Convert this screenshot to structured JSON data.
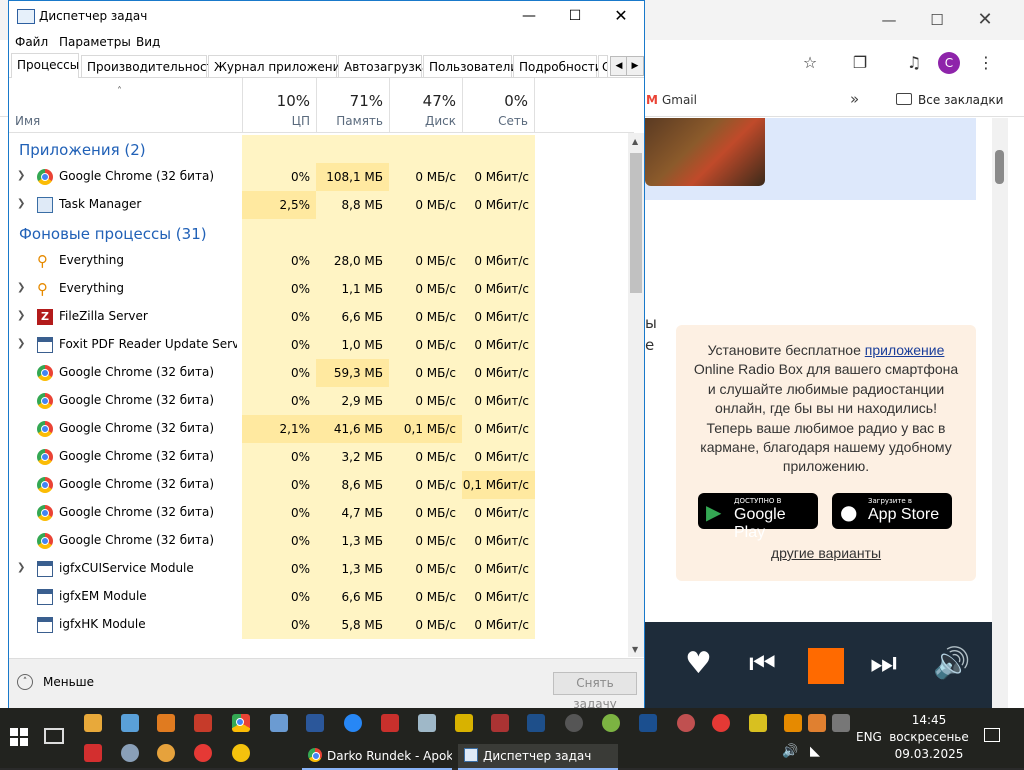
{
  "browser": {
    "bookmarks": {
      "gmail": "Gmail",
      "more": "»",
      "all_bookmarks": "Все закладки"
    },
    "avatar_letter": "С",
    "cut_text": {
      "line1": "ы",
      "line2": "е"
    },
    "promo": {
      "text_before_link": "Установите бесплатное ",
      "link": "приложение",
      "text_after_link": " Online Radio Box для вашего смартфона и слушайте любимые радиостанции онлайн, где бы вы ни находились! Теперь ваше любимое радио у вас в кармане, благодаря нашему удобному приложению.",
      "google_play_small": "ДОСТУПНО В",
      "google_play_big": "Google Play",
      "app_store_small": "Загрузите в",
      "app_store_big": "App Store",
      "other_options": "другие варианты"
    },
    "colors": {
      "promo_bg": "#fdf0e3",
      "player_bg": "#1e2c3a",
      "stop": "#ff6a00",
      "puzzle_bg": "#dde8fb"
    }
  },
  "taskmgr": {
    "title": "Диспетчер задач",
    "menu": [
      "Файл",
      "Параметры",
      "Вид"
    ],
    "tabs": [
      "Процессы",
      "Производительность",
      "Журнал приложений",
      "Автозагрузка",
      "Пользователи",
      "Подробности",
      "С"
    ],
    "active_tab": "Процессы",
    "columns": {
      "name": "Имя",
      "cpu": {
        "pct": "10%",
        "label": "ЦП"
      },
      "mem": {
        "pct": "71%",
        "label": "Память"
      },
      "disk": {
        "pct": "47%",
        "label": "Диск"
      },
      "net": {
        "pct": "0%",
        "label": "Сеть"
      }
    },
    "group_apps": "Приложения (2)",
    "group_bg": "Фоновые процессы (31)",
    "apps": [
      {
        "name": "Google Chrome (32 бита)",
        "icon": "chrome-icon",
        "expand": true,
        "cpu": "0%",
        "mem": "108,1 МБ",
        "disk": "0 МБ/с",
        "net": "0 Мбит/с"
      },
      {
        "name": "Task Manager",
        "icon": "task-manager-icon",
        "expand": true,
        "cpu": "2,5%",
        "mem": "8,8 МБ",
        "disk": "0 МБ/с",
        "net": "0 Мбит/с"
      }
    ],
    "background": [
      {
        "name": "Everything",
        "icon": "everything-icon",
        "expand": false,
        "cpu": "0%",
        "mem": "28,0 МБ",
        "disk": "0 МБ/с",
        "net": "0 Мбит/с"
      },
      {
        "name": "Everything",
        "icon": "everything-icon",
        "expand": true,
        "cpu": "0%",
        "mem": "1,1 МБ",
        "disk": "0 МБ/с",
        "net": "0 Мбит/с"
      },
      {
        "name": "FileZilla Server",
        "icon": "filezilla-icon",
        "expand": true,
        "cpu": "0%",
        "mem": "6,6 МБ",
        "disk": "0 МБ/с",
        "net": "0 Мбит/с"
      },
      {
        "name": "Foxit PDF Reader Update Servic...",
        "icon": "service-icon",
        "expand": true,
        "cpu": "0%",
        "mem": "1,0 МБ",
        "disk": "0 МБ/с",
        "net": "0 Мбит/с"
      },
      {
        "name": "Google Chrome (32 бита)",
        "icon": "chrome-icon",
        "expand": false,
        "cpu": "0%",
        "mem": "59,3 МБ",
        "disk": "0 МБ/с",
        "net": "0 Мбит/с"
      },
      {
        "name": "Google Chrome (32 бита)",
        "icon": "chrome-icon",
        "expand": false,
        "cpu": "0%",
        "mem": "2,9 МБ",
        "disk": "0 МБ/с",
        "net": "0 Мбит/с"
      },
      {
        "name": "Google Chrome (32 бита)",
        "icon": "chrome-icon",
        "expand": false,
        "cpu": "2,1%",
        "mem": "41,6 МБ",
        "disk": "0,1 МБ/с",
        "net": "0 Мбит/с"
      },
      {
        "name": "Google Chrome (32 бита)",
        "icon": "chrome-icon",
        "expand": false,
        "cpu": "0%",
        "mem": "3,2 МБ",
        "disk": "0 МБ/с",
        "net": "0 Мбит/с"
      },
      {
        "name": "Google Chrome (32 бита)",
        "icon": "chrome-icon",
        "expand": false,
        "cpu": "0%",
        "mem": "8,6 МБ",
        "disk": "0 МБ/с",
        "net": "0,1 Мбит/с"
      },
      {
        "name": "Google Chrome (32 бита)",
        "icon": "chrome-icon",
        "expand": false,
        "cpu": "0%",
        "mem": "4,7 МБ",
        "disk": "0 МБ/с",
        "net": "0 Мбит/с"
      },
      {
        "name": "Google Chrome (32 бита)",
        "icon": "chrome-icon",
        "expand": false,
        "cpu": "0%",
        "mem": "1,3 МБ",
        "disk": "0 МБ/с",
        "net": "0 Мбит/с"
      },
      {
        "name": "igfxCUIService Module",
        "icon": "service-icon",
        "expand": true,
        "cpu": "0%",
        "mem": "1,3 МБ",
        "disk": "0 МБ/с",
        "net": "0 Мбит/с"
      },
      {
        "name": "igfxEM Module",
        "icon": "service-icon",
        "expand": false,
        "cpu": "0%",
        "mem": "6,6 МБ",
        "disk": "0 МБ/с",
        "net": "0 Мбит/с"
      },
      {
        "name": "igfxHK Module",
        "icon": "service-icon",
        "expand": false,
        "cpu": "0%",
        "mem": "5,8 МБ",
        "disk": "0 МБ/с",
        "net": "0 Мбит/с"
      }
    ],
    "fewer_details": "Меньше",
    "end_task": "Снять задачу",
    "colors": {
      "cell_light": "#fff4c4",
      "cell_mid": "#ffe9a0",
      "group_title": "#2161b7",
      "border": "#1979ca"
    }
  },
  "taskbar": {
    "apps": [
      {
        "label": "Darko Rundek - Apok...",
        "icon": "chrome-icon"
      },
      {
        "label": "Диспетчер задач",
        "icon": "task-manager-icon"
      }
    ],
    "lang": "ENG",
    "time": "14:45",
    "day": "воскресенье",
    "date": "09.03.2025"
  }
}
